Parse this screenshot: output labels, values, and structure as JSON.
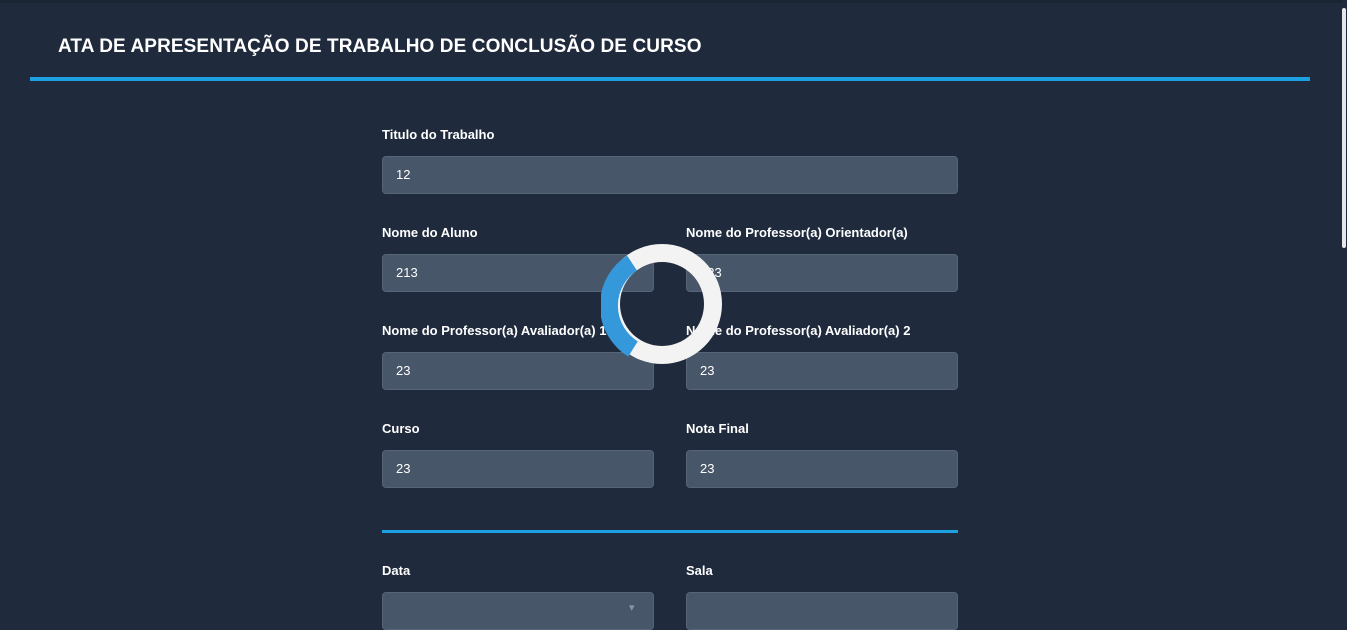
{
  "page": {
    "title": "ATA DE APRESENTAÇÃO DE TRABALHO DE CONCLUSÃO DE CURSO"
  },
  "form": {
    "titulo": {
      "label": "Titulo do Trabalho",
      "value": "12"
    },
    "aluno": {
      "label": "Nome do Aluno",
      "value": "213"
    },
    "orientador": {
      "label": "Nome do Professor(a) Orientador(a)",
      "value": "123"
    },
    "avaliador1": {
      "label": "Nome do Professor(a) Avaliador(a) 1",
      "value": "23"
    },
    "avaliador2": {
      "label": "Nome do Professor(a) Avaliador(a) 2",
      "value": "23"
    },
    "curso": {
      "label": "Curso",
      "value": "23"
    },
    "nota_final": {
      "label": "Nota Final",
      "value": "23"
    },
    "data": {
      "label": "Data",
      "value": ""
    },
    "sala": {
      "label": "Sala",
      "value": ""
    }
  },
  "loading": {
    "visible": true,
    "spinner_color": "#3498db",
    "ring_color": "#f3f3f3"
  },
  "colors": {
    "background": "#1f2a3c",
    "accent": "#1ba1e2",
    "input_bg": "#485669"
  }
}
